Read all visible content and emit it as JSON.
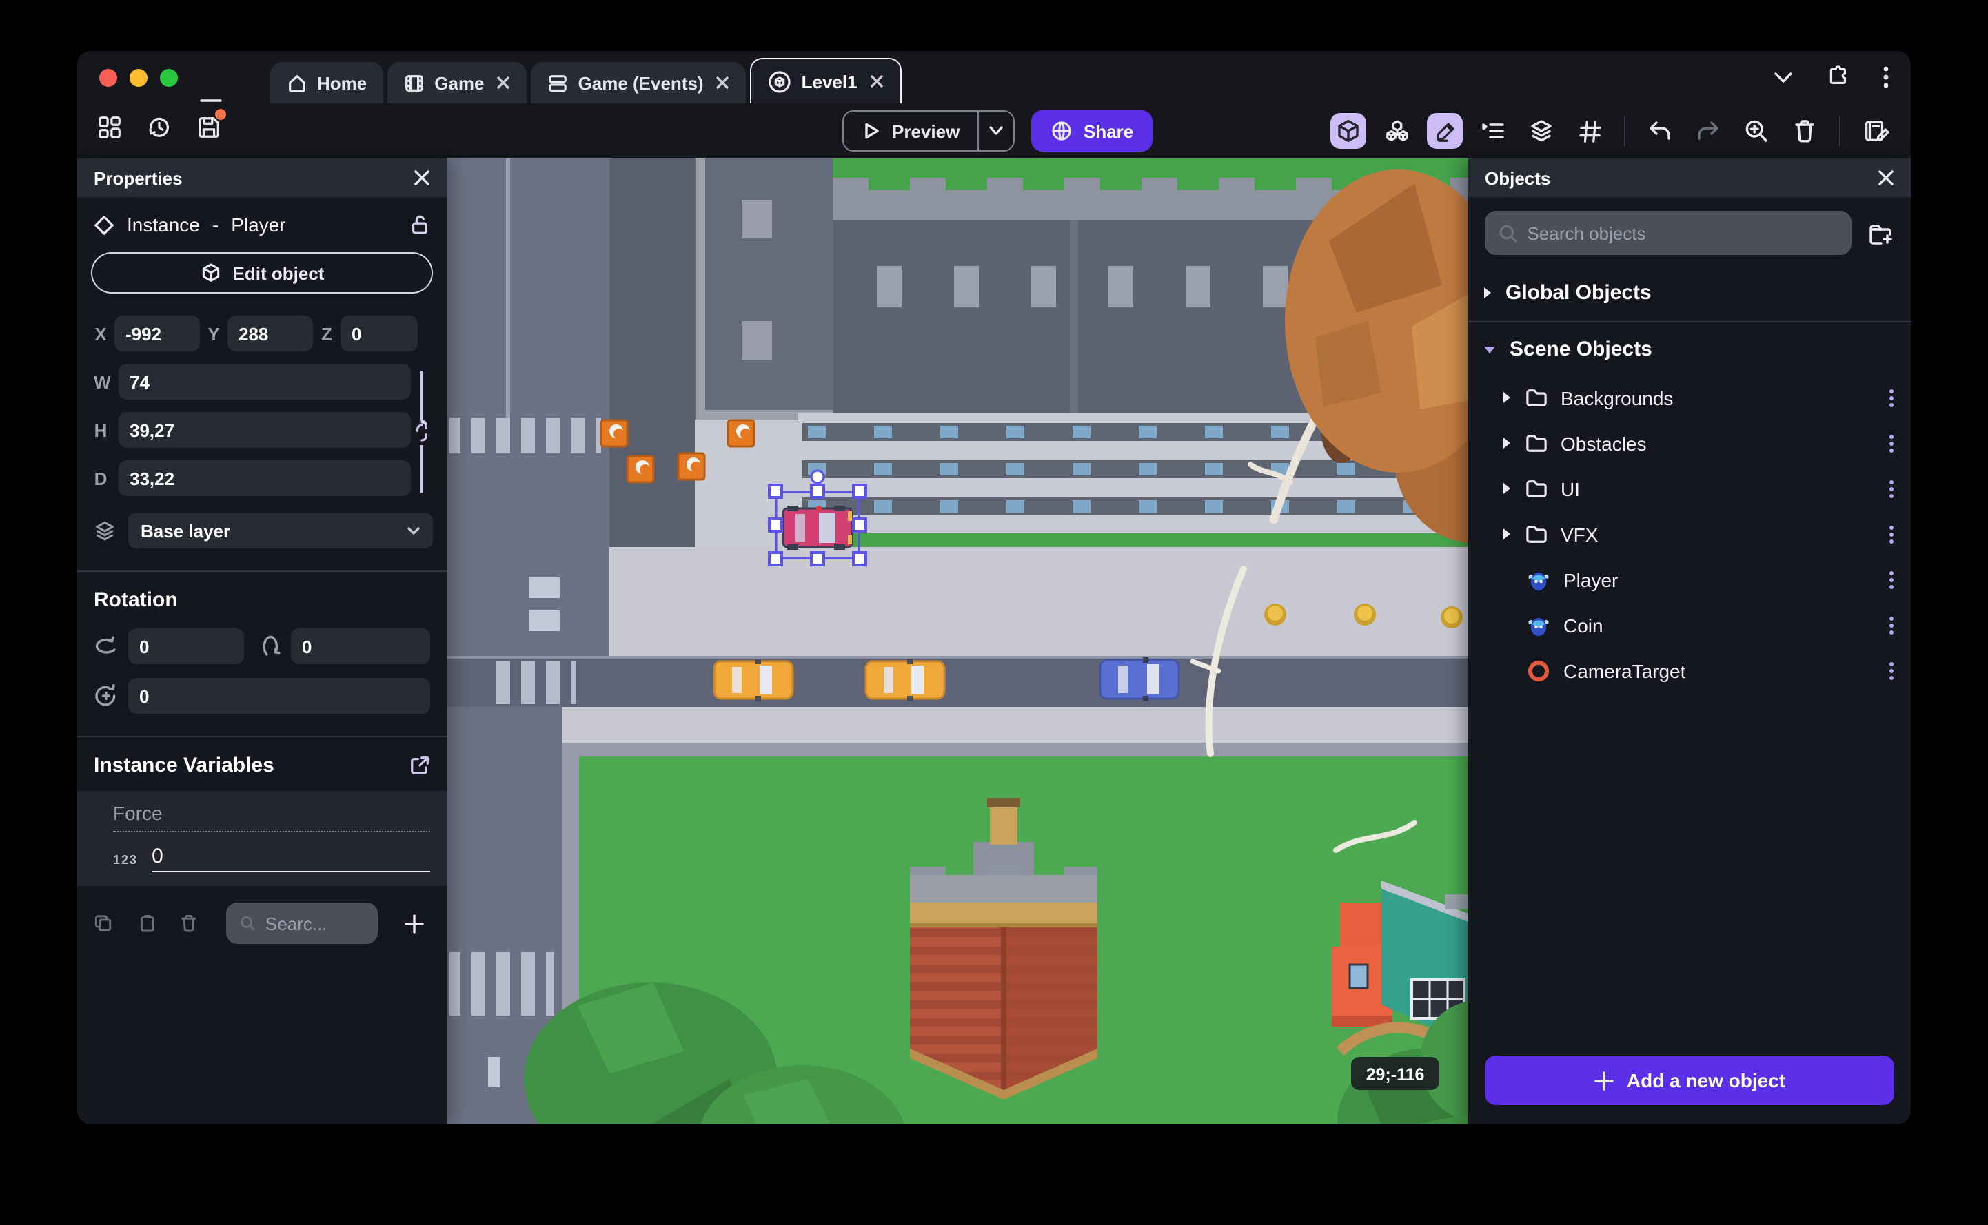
{
  "colors": {
    "accent_purple": "#5b2ee8",
    "selection_purple": "#5d55e8",
    "active_chip_bg": "#cdbdf7",
    "traffic_close": "#ff5f57",
    "traffic_minimize": "#febc2e",
    "traffic_zoom": "#28c840"
  },
  "title_bar": {
    "tabs": [
      {
        "label": "Home"
      },
      {
        "label": "Game"
      },
      {
        "label": "Game (Events)"
      },
      {
        "label": "Level1"
      }
    ]
  },
  "toolbar": {
    "preview_label": "Preview",
    "share_label": "Share"
  },
  "properties_panel": {
    "title": "Properties",
    "instance_label": "Instance",
    "separator": "-",
    "object_name": "Player",
    "edit_object_label": "Edit object",
    "position": {
      "x_label": "X",
      "x_value": "-992",
      "y_label": "Y",
      "y_value": "288",
      "z_label": "Z",
      "z_value": "0"
    },
    "size": {
      "w_label": "W",
      "w_value": "74",
      "h_label": "H",
      "h_value": "39,27",
      "d_label": "D",
      "d_value": "33,22"
    },
    "layer_value": "Base layer",
    "rotation_title": "Rotation",
    "rotation_x": "0",
    "rotation_y": "0",
    "rotation_z": "0",
    "instance_variables_title": "Instance Variables",
    "variable_name": "Force",
    "variable_type_badge": "123",
    "variable_value": "0",
    "search_placeholder": "Searc..."
  },
  "objects_panel": {
    "title": "Objects",
    "search_placeholder": "Search objects",
    "global_objects_label": "Global Objects",
    "scene_objects_label": "Scene Objects",
    "folders": [
      {
        "label": "Backgrounds"
      },
      {
        "label": "Obstacles"
      },
      {
        "label": "UI"
      },
      {
        "label": "VFX"
      }
    ],
    "objects": [
      {
        "label": "Player"
      },
      {
        "label": "Coin"
      },
      {
        "label": "CameraTarget"
      }
    ],
    "add_button_label": "Add a new object"
  },
  "canvas": {
    "coordinate_badge": "29;-116"
  }
}
